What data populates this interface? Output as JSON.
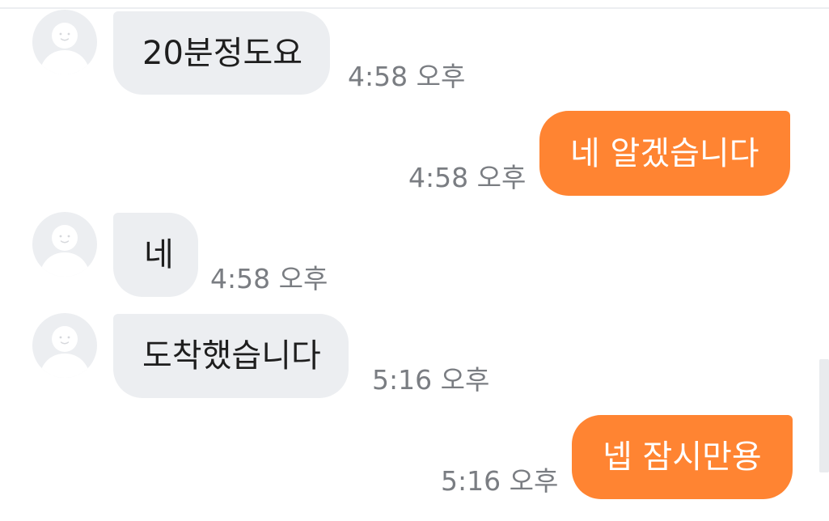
{
  "chat": {
    "messages": [
      {
        "direction": "incoming",
        "text": "20분정도요",
        "time": "4:58 오후"
      },
      {
        "direction": "outgoing",
        "text": "네 알겠습니다",
        "time": "4:58 오후"
      },
      {
        "direction": "incoming",
        "text": "네",
        "time": "4:58 오후"
      },
      {
        "direction": "incoming",
        "text": "도착했습니다",
        "time": "5:16 오후"
      },
      {
        "direction": "outgoing",
        "text": "넵 잠시만용",
        "time": "5:16 오후"
      }
    ]
  },
  "colors": {
    "outgoing_bubble": "#ff8432",
    "incoming_bubble": "#eceef1",
    "timestamp": "#7a7d82",
    "avatar_bg": "#eceef1",
    "avatar_fg": "#ffffff"
  },
  "icons": {
    "avatar": "default-user-avatar-icon"
  }
}
